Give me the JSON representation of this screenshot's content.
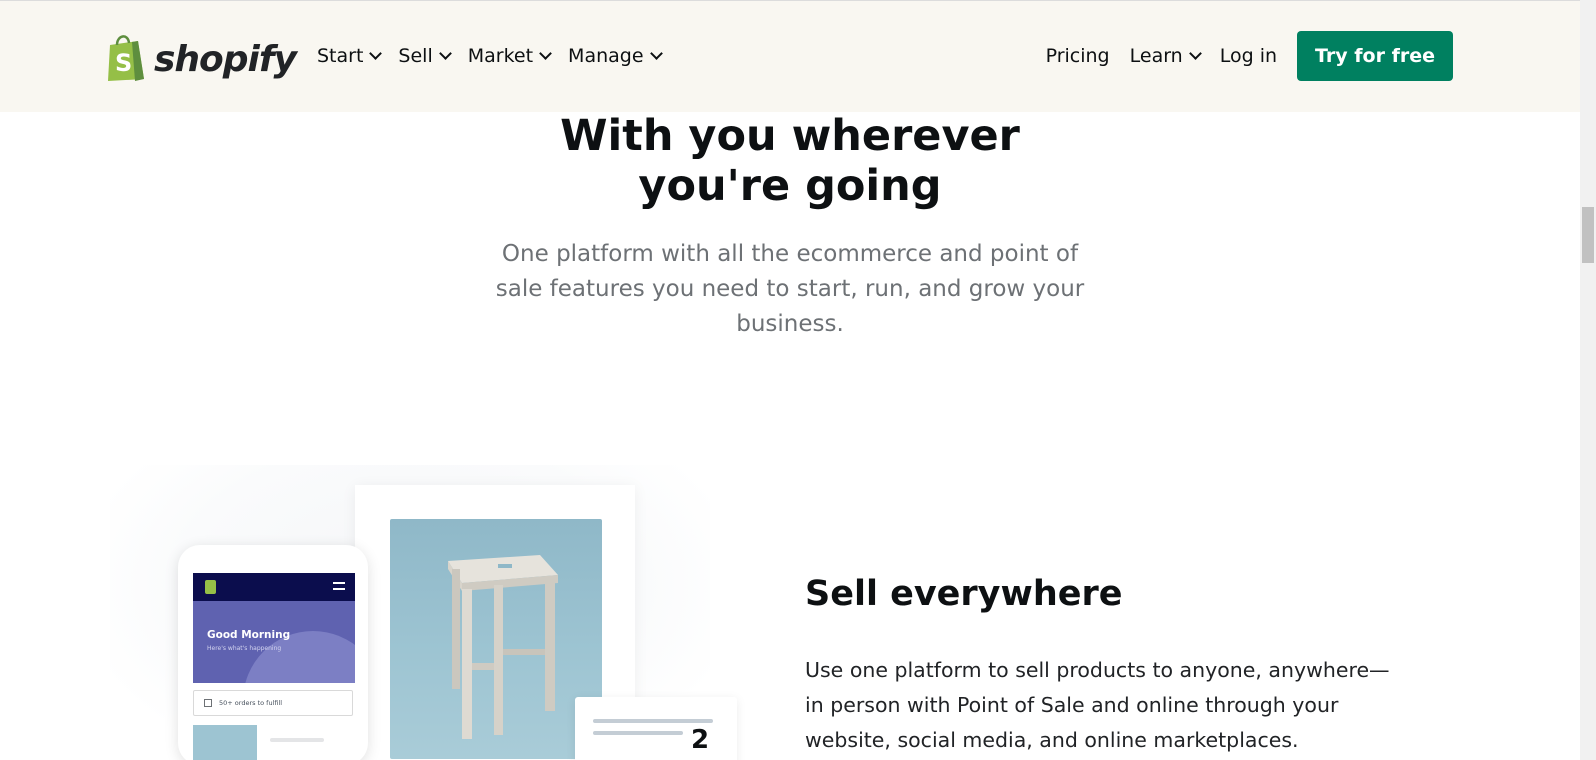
{
  "header": {
    "logo_text": "shopify",
    "nav_left": [
      {
        "label": "Start"
      },
      {
        "label": "Sell"
      },
      {
        "label": "Market"
      },
      {
        "label": "Manage"
      }
    ],
    "nav_right": {
      "pricing": "Pricing",
      "learn": "Learn",
      "login": "Log in",
      "cta": "Try for free"
    }
  },
  "hero": {
    "title": "With you wherever you're going",
    "subtitle": "One platform with all the ecommerce and point of sale features you need to start, run, and grow your business."
  },
  "illustration": {
    "phone_greeting": "Good Morning",
    "phone_greeting_sub": "Here's what's happening",
    "phone_orders": "50+ orders to fulfill",
    "receipt_number": "2"
  },
  "section": {
    "title": "Sell everywhere",
    "body": "Use one platform to sell products to anyone, anywhere—in person with Point of Sale and online through your website, social media, and online marketplaces."
  },
  "colors": {
    "header_bg": "#f9f7f1",
    "cta_bg": "#008060",
    "logo_green": "#95bf47"
  }
}
